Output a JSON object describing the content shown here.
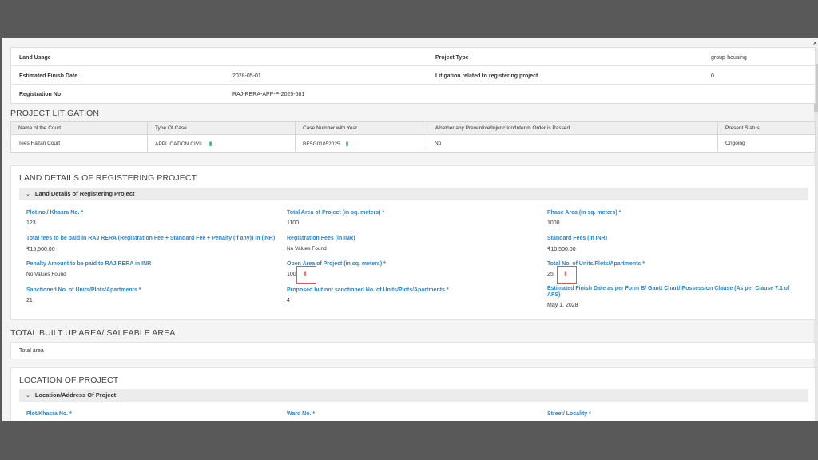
{
  "top_details": [
    {
      "label_left": "Land Usage",
      "value_left": "",
      "label_right": "Project Type",
      "value_right": "group-housing"
    },
    {
      "label_left": "Estimated Finish Date",
      "value_left": "2028-05-01",
      "label_right": "Litigation related to registering project",
      "value_right": "0"
    },
    {
      "label_left": "Registration No",
      "value_left": "RAJ-RERA-APP-P-2025-681",
      "label_right": "",
      "value_right": ""
    }
  ],
  "litigation": {
    "title": "PROJECT LITIGATION",
    "headers": [
      "Name of the Court",
      "Type Of Case",
      "Case Number with Year",
      "Whether any Preventive/Injunction/Interim Order is Passed",
      "Present Status"
    ],
    "rows": [
      [
        "Tees Hazari Court",
        "APPLICATION CIVIL",
        "BFSG01052025",
        "No",
        "Ongoing"
      ]
    ]
  },
  "land": {
    "title": "LAND DETAILS OF REGISTERING PROJECT",
    "sub_title": "Land Details of Registering Project",
    "fields": [
      {
        "label": "Plot no./ Khasra No. *",
        "value": "123"
      },
      {
        "label": "Total Area of Project (in sq. meters) *",
        "value": "1100"
      },
      {
        "label": "Phase Area (in sq. meters) *",
        "value": "1000"
      },
      {
        "label": "Total fees to be paid in RAJ RERA (Registration Fee + Standard Fee + Penalty (If any)) in (INR)",
        "value": "₹15,500.00"
      },
      {
        "label": "Registration Fees (in INR)",
        "value": "No Values Found"
      },
      {
        "label": "Standard Fees (in INR)",
        "value": "₹10,500.00"
      },
      {
        "label": "Penalty Amount to be paid to RAJ RERA in INR",
        "value": "No Values Found"
      },
      {
        "label": "Open Area of Project (in sq. meters) *",
        "value": "100"
      },
      {
        "label": "Total No. of Units/Plots/Apartments *",
        "value": "25"
      },
      {
        "label": "Sanctioned No. of Units/Plots/Apartments *",
        "value": "21"
      },
      {
        "label": "Proposed but not sanctioned No. of Units/Plots/Apartments *",
        "value": "4"
      },
      {
        "label": "Estimated Finish Date as per Form B/ Gantt Chart/ Possession Clause (As per Clause 7.1 of AFS)",
        "value": "May 1, 2028"
      }
    ]
  },
  "builtup": {
    "title": "TOTAL BUILT UP AREA/ SALEABLE AREA",
    "row_label": "Total area"
  },
  "location": {
    "title": "LOCATION OF PROJECT",
    "sub_title": "Location/Address Of Project",
    "fields": [
      "Plot/Khasra No. *",
      "Ward No. *",
      "Street/ Locality *"
    ]
  },
  "colors": {
    "accent": "#2a86c9",
    "comment_green": "#3cb06a",
    "highlight_red": "#e25555"
  },
  "icons": {
    "close": "close-icon",
    "chevron": "chevron-down-icon",
    "comment": "comment-icon"
  }
}
